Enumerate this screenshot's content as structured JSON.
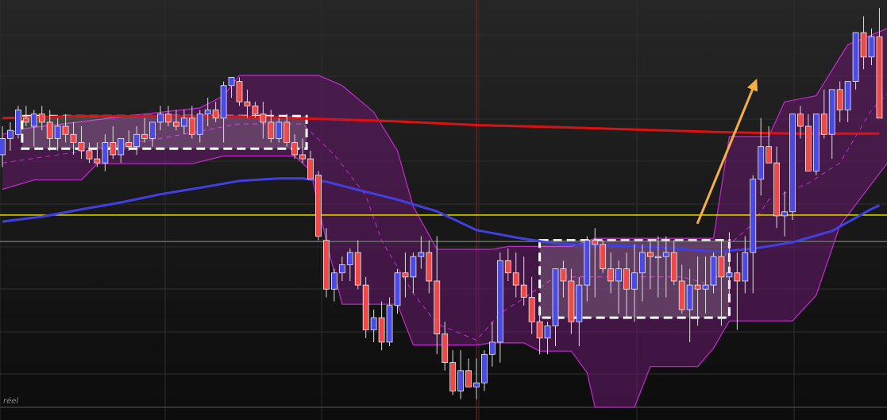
{
  "chart_data": {
    "type": "candlestick",
    "title": "",
    "corner_label": "réel",
    "ylim": [
      0,
      100
    ],
    "x_count": 112,
    "colors": {
      "bull": "#4a4ae8",
      "bear": "#ee4848",
      "ma_long": "#dd1111",
      "ma_short": "#4040e0",
      "level_line": "#e8e000",
      "band_fill": "#6a1a6e",
      "band_edge": "#c02ccc",
      "arrow": "#f4b040",
      "box_edge": "#ffffff",
      "background": "#141414",
      "grid": "#2e2e2e",
      "cursor": "#8a2222",
      "ref_line": "#6a6a6a"
    },
    "level_line": 47.2,
    "ref_line": 40.7,
    "ma_long": [
      [
        0,
        71
      ],
      [
        10,
        71.5
      ],
      [
        30,
        71.4
      ],
      [
        40,
        70.8
      ],
      [
        50,
        70.2
      ],
      [
        60,
        69.3
      ],
      [
        70,
        68.8
      ],
      [
        80,
        68.2
      ],
      [
        90,
        67.6
      ],
      [
        100,
        67.2
      ],
      [
        111,
        67.2
      ]
    ],
    "ma_short": [
      [
        0,
        45.6
      ],
      [
        5,
        46.8
      ],
      [
        10,
        48.6
      ],
      [
        15,
        50.3
      ],
      [
        20,
        52.3
      ],
      [
        25,
        53.9
      ],
      [
        30,
        55.6
      ],
      [
        35,
        56.2
      ],
      [
        38,
        56.2
      ],
      [
        41,
        55.4
      ],
      [
        45,
        53.4
      ],
      [
        50,
        51.0
      ],
      [
        55,
        48.1
      ],
      [
        60,
        43.5
      ],
      [
        65,
        41.7
      ],
      [
        70,
        40.2
      ],
      [
        75,
        39.8
      ],
      [
        80,
        39.6
      ],
      [
        85,
        39.0
      ],
      [
        90,
        38.2
      ],
      [
        95,
        38.9
      ],
      [
        100,
        40.5
      ],
      [
        105,
        43.3
      ],
      [
        110,
        48.7
      ],
      [
        111,
        49.6
      ]
    ],
    "channel_upper": [
      [
        0,
        67
      ],
      [
        3,
        68.5
      ],
      [
        18,
        72
      ],
      [
        25,
        73.5
      ],
      [
        28,
        76.5
      ],
      [
        30,
        81.5
      ],
      [
        40,
        81.5
      ],
      [
        43,
        79
      ],
      [
        47,
        72.5
      ],
      [
        50,
        63
      ],
      [
        52,
        49.3
      ],
      [
        55,
        38.8
      ],
      [
        62,
        38.8
      ],
      [
        64,
        39.5
      ],
      [
        72,
        39.5
      ],
      [
        75,
        41.5
      ],
      [
        90,
        41.5
      ],
      [
        92,
        66.5
      ],
      [
        97,
        66.5
      ],
      [
        99,
        75
      ],
      [
        103,
        76.5
      ],
      [
        107,
        89
      ],
      [
        112,
        93
      ]
    ],
    "channel_lower": [
      [
        0,
        53.5
      ],
      [
        4,
        55.8
      ],
      [
        10,
        55.8
      ],
      [
        12,
        59.8
      ],
      [
        24,
        59.8
      ],
      [
        28,
        61.7
      ],
      [
        37,
        61.7
      ],
      [
        39,
        58.1
      ],
      [
        41,
        40.9
      ],
      [
        43,
        25.3
      ],
      [
        50,
        25.3
      ],
      [
        52,
        15.3
      ],
      [
        60,
        15.3
      ],
      [
        62,
        15.8
      ],
      [
        66,
        15.8
      ],
      [
        68,
        13.8
      ],
      [
        72,
        13.8
      ],
      [
        74,
        8.5
      ],
      [
        75,
        0
      ],
      [
        80,
        0
      ],
      [
        82,
        10
      ],
      [
        88,
        10
      ],
      [
        90,
        14.5
      ],
      [
        92,
        21.2
      ],
      [
        100,
        21.2
      ],
      [
        103,
        27.5
      ],
      [
        106,
        44.6
      ],
      [
        112,
        60
      ]
    ],
    "channel_mid": [
      [
        0,
        60
      ],
      [
        10,
        62.8
      ],
      [
        20,
        66
      ],
      [
        30,
        69.6
      ],
      [
        38,
        69.6
      ],
      [
        42,
        62
      ],
      [
        46,
        52
      ],
      [
        48,
        40.9
      ],
      [
        52,
        28
      ],
      [
        55,
        20.5
      ],
      [
        60,
        16.5
      ],
      [
        63,
        23
      ],
      [
        66,
        26.8
      ],
      [
        70,
        32
      ],
      [
        76,
        32
      ],
      [
        86,
        32
      ],
      [
        90,
        30
      ],
      [
        92,
        40
      ],
      [
        95,
        45
      ],
      [
        97,
        51
      ],
      [
        102,
        55
      ],
      [
        106,
        60
      ],
      [
        110,
        73
      ],
      [
        112,
        77
      ]
    ],
    "consolidation_boxes": [
      [
        2.5,
        63.5,
        38.5,
        71.5
      ],
      [
        68,
        22,
        92,
        41
      ]
    ],
    "arrow": {
      "from": [
        88,
        45.3
      ],
      "to": [
        95.5,
        80.7
      ]
    },
    "cursor_x": 60,
    "candles": [
      [
        0,
        62,
        69,
        59,
        66
      ],
      [
        1,
        66,
        70,
        63,
        68
      ],
      [
        2,
        67,
        74,
        66,
        73
      ],
      [
        3,
        71,
        74,
        69,
        70
      ],
      [
        4,
        69,
        73,
        64,
        72
      ],
      [
        5,
        72,
        74,
        68,
        70
      ],
      [
        6,
        70,
        73,
        63,
        66
      ],
      [
        7,
        66,
        71,
        63,
        69
      ],
      [
        8,
        69,
        72,
        65,
        67
      ],
      [
        9,
        67,
        70,
        62,
        65
      ],
      [
        10,
        65,
        69,
        61,
        63
      ],
      [
        11,
        63,
        65,
        60,
        61
      ],
      [
        12,
        61,
        65,
        59,
        60
      ],
      [
        13,
        60,
        67,
        58,
        65
      ],
      [
        14,
        65,
        69,
        61,
        62
      ],
      [
        15,
        62,
        66,
        60,
        66
      ],
      [
        16,
        65,
        68,
        63,
        64
      ],
      [
        17,
        64,
        69,
        62,
        67
      ],
      [
        18,
        67,
        71,
        65,
        66
      ],
      [
        19,
        66,
        70,
        64,
        70
      ],
      [
        20,
        70,
        74,
        68,
        72
      ],
      [
        21,
        72,
        74,
        69,
        70
      ],
      [
        22,
        70,
        73,
        68,
        69
      ],
      [
        23,
        69,
        73,
        67,
        71
      ],
      [
        24,
        71,
        74,
        66,
        67
      ],
      [
        25,
        67,
        73,
        65,
        72
      ],
      [
        26,
        72,
        76,
        69,
        73
      ],
      [
        27,
        73,
        75,
        70,
        71
      ],
      [
        28,
        71,
        80,
        65,
        79
      ],
      [
        29,
        79,
        81,
        76,
        81
      ],
      [
        30,
        80,
        81,
        74,
        75
      ],
      [
        31,
        75,
        78,
        71,
        74
      ],
      [
        32,
        74,
        75,
        71,
        72
      ],
      [
        33,
        72,
        75,
        66,
        70
      ],
      [
        34,
        70,
        73,
        65,
        66
      ],
      [
        35,
        66,
        71,
        65,
        70
      ],
      [
        36,
        70,
        72,
        64,
        65
      ],
      [
        37,
        65,
        67,
        61,
        62
      ],
      [
        38,
        62,
        66,
        60,
        61
      ],
      [
        39,
        61,
        63,
        57,
        56
      ],
      [
        40,
        57,
        58,
        41,
        42
      ],
      [
        41,
        41,
        44,
        27,
        29
      ],
      [
        42,
        29,
        34,
        26,
        33
      ],
      [
        43,
        33,
        37,
        31,
        35
      ],
      [
        44,
        35,
        39,
        31,
        38
      ],
      [
        45,
        38,
        41,
        29,
        30
      ],
      [
        46,
        30,
        32,
        17,
        19
      ],
      [
        47,
        19,
        24,
        16,
        22
      ],
      [
        48,
        22,
        26,
        14,
        16
      ],
      [
        49,
        16,
        27,
        15,
        25
      ],
      [
        50,
        25,
        34,
        23,
        33
      ],
      [
        51,
        33,
        38,
        27,
        32
      ],
      [
        52,
        32,
        38,
        28,
        37
      ],
      [
        53,
        37,
        42,
        34,
        38
      ],
      [
        54,
        38,
        41,
        28,
        31
      ],
      [
        55,
        31,
        42,
        13,
        18
      ],
      [
        56,
        18,
        21,
        9,
        11
      ],
      [
        57,
        11,
        14,
        3,
        4
      ],
      [
        58,
        4,
        14,
        2,
        9
      ],
      [
        59,
        9,
        12,
        5,
        5
      ],
      [
        60,
        5,
        12,
        2,
        6
      ],
      [
        61,
        6,
        14,
        4,
        13
      ],
      [
        62,
        13,
        21,
        10,
        16
      ],
      [
        63,
        16,
        38,
        11,
        36
      ],
      [
        64,
        36,
        39,
        31,
        33
      ],
      [
        65,
        33,
        38,
        27,
        30
      ],
      [
        66,
        30,
        37,
        25,
        27
      ],
      [
        67,
        27,
        32,
        18,
        21
      ],
      [
        68,
        21,
        25,
        13,
        17
      ],
      [
        69,
        17,
        21,
        13,
        20
      ],
      [
        70,
        20,
        34,
        15,
        34
      ],
      [
        71,
        34,
        36,
        27,
        31
      ],
      [
        72,
        31,
        34,
        18,
        21
      ],
      [
        73,
        21,
        32,
        15,
        30
      ],
      [
        74,
        30,
        42,
        26,
        41
      ],
      [
        75,
        41,
        44,
        27,
        40
      ],
      [
        76,
        40,
        41,
        33,
        34
      ],
      [
        77,
        34,
        38,
        28,
        31
      ],
      [
        78,
        31,
        36,
        23,
        34
      ],
      [
        79,
        34,
        38,
        22,
        29
      ],
      [
        80,
        29,
        40,
        21,
        33
      ],
      [
        81,
        33,
        40,
        26,
        38
      ],
      [
        82,
        38,
        41,
        29,
        37
      ],
      [
        83,
        37,
        42,
        27,
        37
      ],
      [
        84,
        37,
        42,
        27,
        38
      ],
      [
        85,
        38,
        41,
        30,
        31
      ],
      [
        86,
        31,
        35,
        23,
        24
      ],
      [
        87,
        24,
        34,
        16,
        30
      ],
      [
        88,
        30,
        37,
        20,
        29
      ],
      [
        89,
        29,
        37,
        23,
        30
      ],
      [
        90,
        30,
        38,
        28,
        37
      ],
      [
        91,
        37,
        41,
        20,
        32
      ],
      [
        92,
        32,
        43,
        27,
        33
      ],
      [
        93,
        33,
        38,
        19,
        31
      ],
      [
        94,
        31,
        42,
        28,
        38
      ],
      [
        95,
        38,
        57,
        28,
        56
      ],
      [
        96,
        56,
        71,
        52,
        64
      ],
      [
        97,
        64,
        69,
        60,
        60
      ],
      [
        98,
        60,
        64,
        44,
        47
      ],
      [
        99,
        47,
        53,
        42,
        48
      ],
      [
        100,
        48,
        71,
        46,
        72
      ],
      [
        101,
        72,
        74,
        66,
        69
      ],
      [
        102,
        69,
        72,
        58,
        58
      ],
      [
        103,
        58,
        72,
        57,
        72
      ],
      [
        104,
        72,
        78,
        66,
        67
      ],
      [
        105,
        67,
        78,
        61,
        78
      ],
      [
        106,
        78,
        80,
        70,
        73
      ],
      [
        107,
        73,
        80,
        70,
        80
      ],
      [
        108,
        80,
        92,
        78,
        92
      ],
      [
        109,
        92,
        96,
        83,
        86
      ],
      [
        110,
        86,
        93,
        84,
        91
      ],
      [
        111,
        91,
        98,
        75,
        71
      ]
    ]
  }
}
